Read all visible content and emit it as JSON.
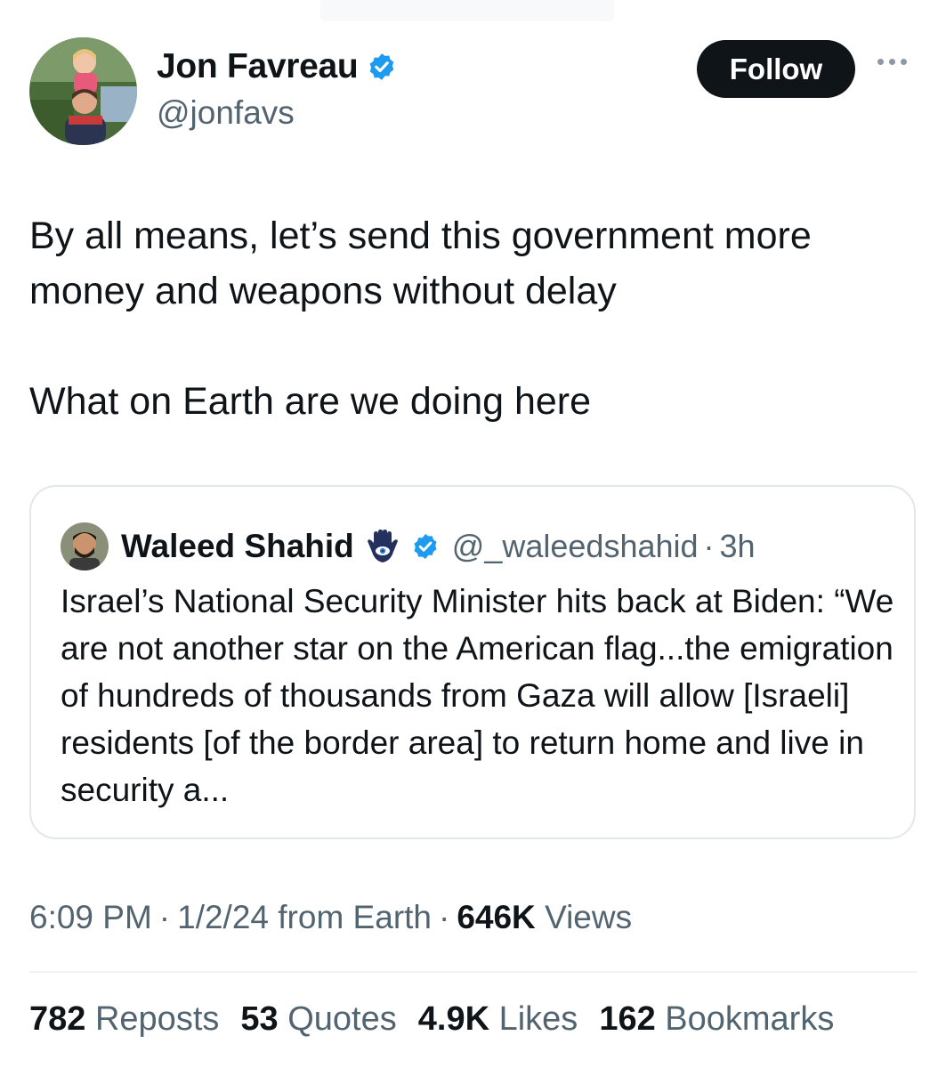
{
  "author": {
    "name": "Jon Favreau",
    "handle": "@jonfavs",
    "verified": true
  },
  "follow_label": "Follow",
  "tweet": {
    "paragraphs": [
      "By all means, let’s send this government more money and weapons without delay",
      "What on Earth are we doing here"
    ]
  },
  "quote": {
    "name": "Waleed Shahid",
    "handle": "@_waleedshahid",
    "separator": "·",
    "time": "3h",
    "text": "Israel’s National Security Minister hits back at Biden: “We are not another star on the American flag...the emigration of hundreds of thousands from Gaza will allow [Israeli] residents [of the border area] to return home and live in security a..."
  },
  "meta": {
    "time": "6:09 PM",
    "separator": "·",
    "date": "1/2/24",
    "source": "from Earth",
    "views_count": "646K",
    "views_label": "Views"
  },
  "stats": {
    "reposts": {
      "count": "782",
      "label": "Reposts"
    },
    "quotes": {
      "count": "53",
      "label": "Quotes"
    },
    "likes": {
      "count": "4.9K",
      "label": "Likes"
    },
    "bookmarks": {
      "count": "162",
      "label": "Bookmarks"
    }
  },
  "colors": {
    "text": "#0f1419",
    "secondary": "#536471",
    "verified": "#1d9bf0",
    "border": "#e1e8ed",
    "follow_bg": "#0f1419"
  },
  "icons": [
    "verified-badge-icon",
    "more-options-icon",
    "hamsa-icon"
  ]
}
